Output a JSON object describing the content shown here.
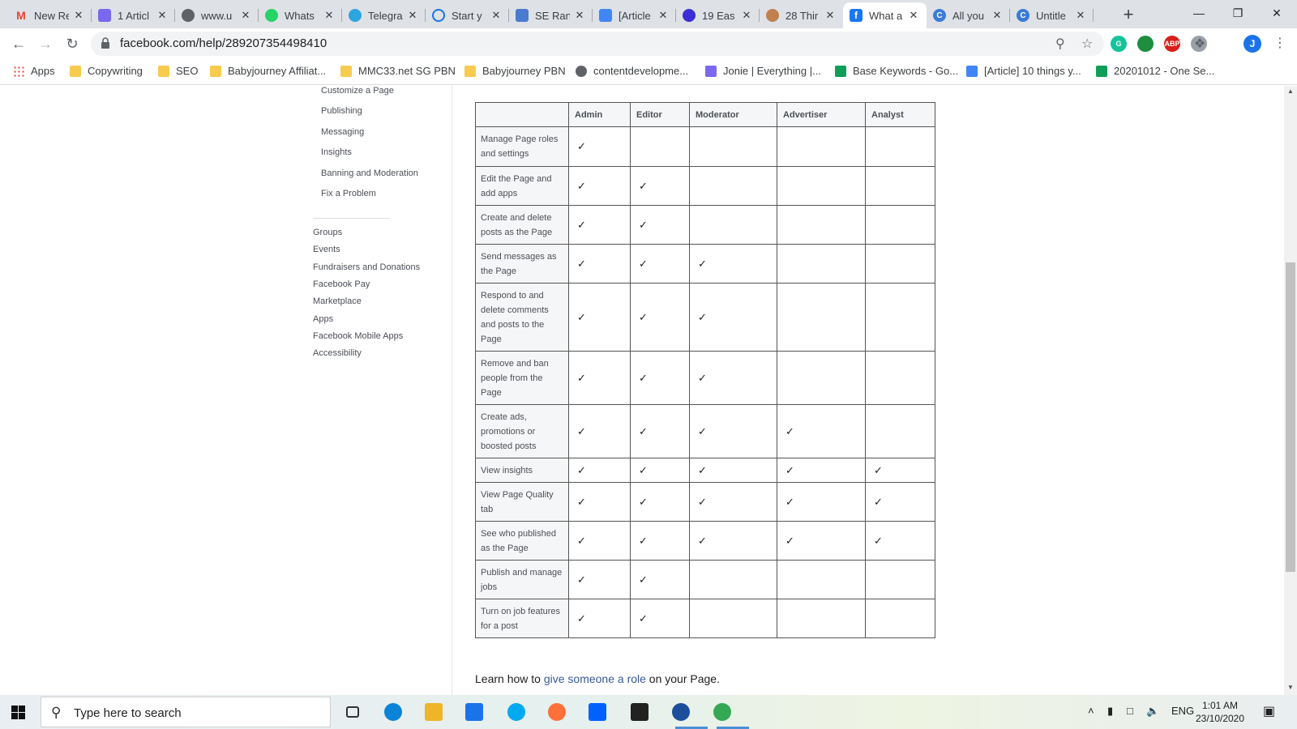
{
  "browser": {
    "tabs": [
      {
        "title": "New Re",
        "icon": "gmail-icon",
        "color": "#ea4335"
      },
      {
        "title": "1 Articl",
        "icon": "clickup-icon",
        "color": "#7b68ee"
      },
      {
        "title": "www.u",
        "icon": "globe-icon",
        "color": "#5f6368"
      },
      {
        "title": "Whats",
        "icon": "whatsapp-icon",
        "color": "#25d366"
      },
      {
        "title": "Telegra",
        "icon": "telegram-icon",
        "color": "#2ca5e0"
      },
      {
        "title": "Start y",
        "icon": "loading-icon",
        "color": "#1a73e8"
      },
      {
        "title": "SE Ran",
        "icon": "seranking-icon",
        "color": "#4a7bd0"
      },
      {
        "title": "[Article",
        "icon": "docs-icon",
        "color": "#4285f4"
      },
      {
        "title": "19 Eas",
        "icon": "circle-icon",
        "color": "#3c2dd6"
      },
      {
        "title": "28 Thir",
        "icon": "face-icon",
        "color": "#c08050"
      },
      {
        "title": "What a",
        "icon": "facebook-icon",
        "color": "#1877f2"
      },
      {
        "title": "All you",
        "icon": "canva-icon",
        "color": "#3a7bd5"
      },
      {
        "title": "Untitle",
        "icon": "canva-icon",
        "color": "#3a7bd5"
      }
    ],
    "url": "facebook.com/help/289207354498410",
    "profile_initial": "J",
    "extensions": [
      {
        "icon": "grammarly-icon",
        "label": "G",
        "color": "#15c39a"
      },
      {
        "icon": "shield-icon",
        "label": "",
        "color": "#1e8e3e"
      },
      {
        "icon": "adblock-icon",
        "label": "ABP",
        "color": "#d7201b"
      },
      {
        "icon": "arc-icon",
        "label": "",
        "color": "#9aa0a6"
      }
    ]
  },
  "bookmarks": [
    {
      "label": "Apps",
      "icon": "apps-grid-icon"
    },
    {
      "label": "Copywriting",
      "icon": "folder-icon"
    },
    {
      "label": "SEO",
      "icon": "folder-icon"
    },
    {
      "label": "Babyjourney Affiliat...",
      "icon": "folder-icon"
    },
    {
      "label": "MMC33.net SG PBN",
      "icon": "folder-icon"
    },
    {
      "label": "Babyjourney PBN",
      "icon": "folder-icon"
    },
    {
      "label": "contentdevelopme...",
      "icon": "globe-icon"
    },
    {
      "label": "Jonie | Everything |...",
      "icon": "clickup-icon"
    },
    {
      "label": "Base Keywords - Go...",
      "icon": "sheets-icon"
    },
    {
      "label": "[Article] 10 things y...",
      "icon": "docs-icon"
    },
    {
      "label": "20201012 - One Se...",
      "icon": "sheets-icon"
    }
  ],
  "sidebar": {
    "sub_items": [
      "Customize a Page",
      "Publishing",
      "Messaging",
      "Insights",
      "Banning and Moderation",
      "Fix a Problem"
    ],
    "main_items": [
      "Groups",
      "Events",
      "Fundraisers and Donations",
      "Facebook Pay",
      "Marketplace",
      "Apps",
      "Facebook Mobile Apps",
      "Accessibility"
    ]
  },
  "roles_table": {
    "columns": [
      "",
      "Admin",
      "Editor",
      "Moderator",
      "Advertiser",
      "Analyst"
    ],
    "check_mark": "✓",
    "rows": [
      {
        "feature": "Manage Page roles and settings",
        "checks": [
          true,
          false,
          false,
          false,
          false
        ]
      },
      {
        "feature": "Edit the Page and add apps",
        "checks": [
          true,
          true,
          false,
          false,
          false
        ]
      },
      {
        "feature": "Create and delete posts as the Page",
        "checks": [
          true,
          true,
          false,
          false,
          false
        ]
      },
      {
        "feature": "Send messages as the Page",
        "checks": [
          true,
          true,
          true,
          false,
          false
        ]
      },
      {
        "feature": "Respond to and delete comments and posts to the Page",
        "checks": [
          true,
          true,
          true,
          false,
          false
        ]
      },
      {
        "feature": "Remove and ban people from the Page",
        "checks": [
          true,
          true,
          true,
          false,
          false
        ]
      },
      {
        "feature": "Create ads, promotions or boosted posts",
        "checks": [
          true,
          true,
          true,
          true,
          false
        ]
      },
      {
        "feature": "View insights",
        "checks": [
          true,
          true,
          true,
          true,
          true
        ]
      },
      {
        "feature": "View Page Quality tab",
        "checks": [
          true,
          true,
          true,
          true,
          true
        ]
      },
      {
        "feature": "See who published as the Page",
        "checks": [
          true,
          true,
          true,
          true,
          true
        ]
      },
      {
        "feature": "Publish and manage jobs",
        "checks": [
          true,
          true,
          false,
          false,
          false
        ]
      },
      {
        "feature": "Turn on job features for a post",
        "checks": [
          true,
          true,
          false,
          false,
          false
        ]
      }
    ]
  },
  "learn": {
    "prefix": "Learn how to ",
    "link": "give someone a role",
    "suffix": " on your Page."
  },
  "taskbar": {
    "search_placeholder": "Type here to search",
    "language": "ENG",
    "time": "1:01 AM",
    "date": "23/10/2020",
    "apps": [
      "task-view-icon",
      "edge-icon",
      "file-explorer-icon",
      "mail-icon",
      "skype-icon",
      "firefox-icon",
      "dropbox-icon",
      "amazon-icon",
      "app-icon",
      "chrome-icon"
    ]
  }
}
